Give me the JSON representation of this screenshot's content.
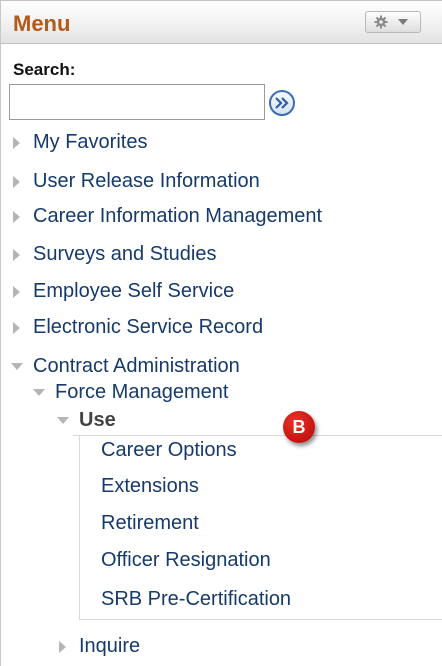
{
  "header": {
    "title": "Menu",
    "title_color": "#b15a1a",
    "options_icon": "gear-icon"
  },
  "search": {
    "label": "Search:",
    "value": "",
    "placeholder": "",
    "go_icon": "double-chevron-right-icon"
  },
  "menu": {
    "items": [
      {
        "label": "My Favorites",
        "state": "collapsed"
      },
      {
        "label": "User Release Information",
        "state": "collapsed"
      },
      {
        "label": "Career Information Management",
        "state": "collapsed"
      },
      {
        "label": "Surveys and Studies",
        "state": "collapsed"
      },
      {
        "label": "Employee Self Service",
        "state": "collapsed"
      },
      {
        "label": "Electronic Service Record",
        "state": "collapsed"
      },
      {
        "label": "Contract Administration",
        "state": "expanded"
      }
    ],
    "force_management": {
      "label": "Force Management",
      "state": "expanded"
    },
    "use": {
      "label": "Use",
      "state": "expanded"
    },
    "use_items": [
      {
        "label": "Career Options"
      },
      {
        "label": "Extensions"
      },
      {
        "label": "Retirement"
      },
      {
        "label": "Officer Resignation"
      },
      {
        "label": "SRB Pre-Certification"
      }
    ],
    "inquire": {
      "label": "Inquire",
      "state": "collapsed"
    }
  },
  "badge": {
    "text": "B",
    "color": "#c4140f"
  },
  "colors": {
    "link": "#163a6b",
    "triangle": "#b5b5b5"
  }
}
